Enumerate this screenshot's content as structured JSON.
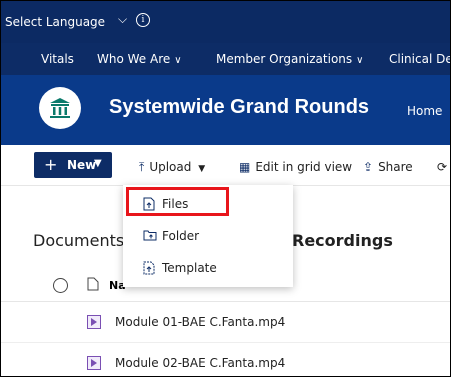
{
  "language_bar": {
    "label": "Select Language",
    "chevron": "⌵",
    "info": "i"
  },
  "nav": {
    "items": [
      {
        "label": "Vitals",
        "dropdown": false
      },
      {
        "label": "Who We Are",
        "dropdown": true
      },
      {
        "label": "Member Organizations",
        "dropdown": true
      },
      {
        "label": "Clinical Dep",
        "dropdown": false
      }
    ]
  },
  "site": {
    "title": "Systemwide Grand Rounds",
    "home": "Home"
  },
  "commands": {
    "new_label": "New",
    "upload_label": "Upload",
    "edit_grid_label": "Edit in grid view",
    "share_label": "Share"
  },
  "upload_menu": {
    "items": [
      {
        "label": "Files",
        "icon": "file-upload-icon"
      },
      {
        "label": "Folder",
        "icon": "folder-upload-icon"
      },
      {
        "label": "Template",
        "icon": "template-upload-icon"
      }
    ],
    "highlighted": "Files",
    "highlight_color": "#e8151b"
  },
  "breadcrumb": {
    "root": "Documents",
    "separator": ">",
    "current": "Recordings"
  },
  "table": {
    "name_header": "Na",
    "rows": [
      {
        "name": "Module 01-BAE C.Fanta.mp4",
        "icon": "video-file-icon"
      },
      {
        "name": "Module 02-BAE C.Fanta.mp4",
        "icon": "video-file-icon"
      }
    ]
  },
  "colors": {
    "nav_bg": "#0c2a63",
    "header_bg": "#0a3a8a",
    "accent": "#0d2c66",
    "highlight": "#e8151b"
  }
}
